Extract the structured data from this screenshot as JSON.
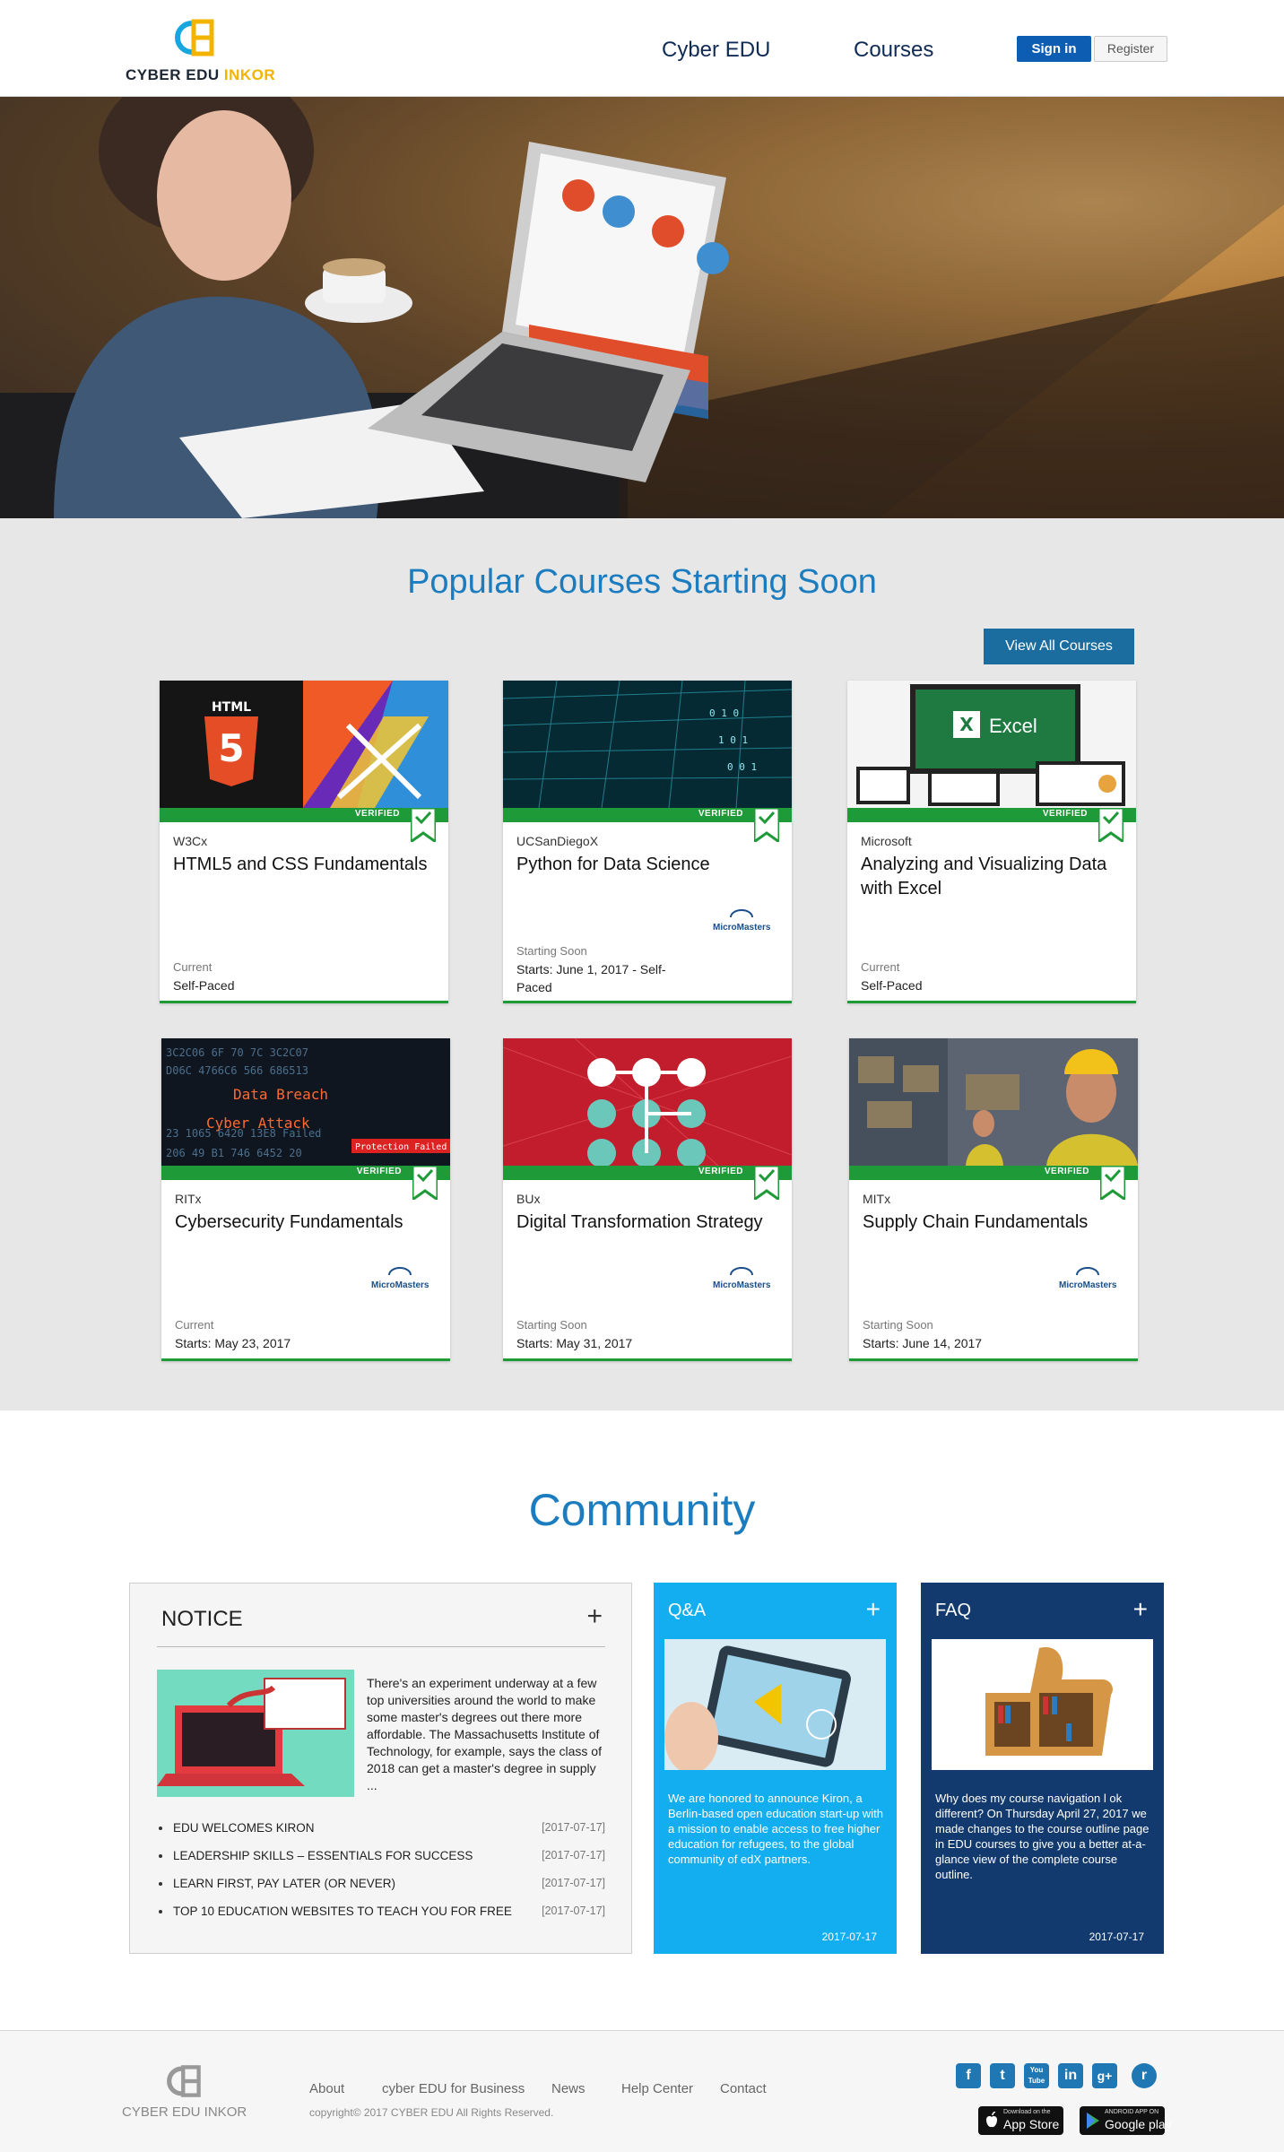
{
  "header": {
    "logo_text_main": "CYBER EDU",
    "logo_text_accent": "INKOR",
    "nav": [
      "Cyber EDU",
      "Courses"
    ],
    "signin_label": "Sign in",
    "register_label": "Register"
  },
  "courses": {
    "title": "Popular Courses Starting Soon",
    "view_all_label": "View All Courses",
    "verified_label": "VERIFIED",
    "micromasters_label": "MicroMasters",
    "items": [
      {
        "org": "W3Cx",
        "title": "HTML5 and CSS Fundamentals",
        "status": "Current",
        "date": "Self-Paced"
      },
      {
        "org": "UCSanDiegoX",
        "title": "Python for Data Science",
        "status": "Starting Soon",
        "date": "Starts: June 1, 2017 - Self-Paced"
      },
      {
        "org": "Microsoft",
        "title": "Analyzing and Visualizing Data with Excel",
        "status": "Current",
        "date": "Self-Paced"
      },
      {
        "org": "RITx",
        "title": "Cybersecurity Fundamentals",
        "status": "Current",
        "date": "Starts: May 23, 2017"
      },
      {
        "org": "BUx",
        "title": "Digital Transformation Strategy",
        "status": "Starting Soon",
        "date": "Starts: May 31, 2017"
      },
      {
        "org": "MITx",
        "title": "Supply Chain Fundamentals",
        "status": "Starting Soon",
        "date": "Starts: June 14, 2017"
      }
    ],
    "image_text": {
      "html_badge": "HTML",
      "excel": "Excel",
      "data_breach": "Data Breach",
      "cyber_attack": "Cyber Attack",
      "protection_failed": "Protection Failed"
    }
  },
  "community": {
    "title": "Community",
    "notice": {
      "title": "NOTICE",
      "text": "There's an experiment underway at a few top universities around the world to make some master's degrees out there more affordable. The Massachusetts Institute of Technology, for example, says the class of 2018 can get a master's degree in supply ...",
      "list": [
        {
          "title": "EDU WELCOMES KIRON",
          "date": "[2017-07-17]"
        },
        {
          "title": "LEADERSHIP SKILLS – ESSENTIALS FOR SUCCESS",
          "date": "[2017-07-17]"
        },
        {
          "title": "LEARN FIRST, PAY LATER (OR NEVER)",
          "date": "[2017-07-17]"
        },
        {
          "title": "TOP 10 EDUCATION WEBSITES TO TEACH YOU FOR FREE",
          "date": "[2017-07-17]"
        }
      ]
    },
    "qa": {
      "title": "Q&A",
      "text": "We are honored to announce Kiron, a Berlin-based open education start-up with a mission to enable access to free higher education for refugees, to the global community of edX partners.",
      "date": "2017-07-17"
    },
    "faq": {
      "title": "FAQ",
      "text": "Why does my course navigation l ok different? On Thursday April 27, 2017 we made changes to the course outline page in EDU courses to give you a better at-a-glance view of the complete course outline.",
      "date": "2017-07-17"
    },
    "plus": "+"
  },
  "footer": {
    "logo_text": "CYBER EDU INKOR",
    "links": [
      "About",
      "cyber EDU for Business",
      "News",
      "Help Center",
      "Contact"
    ],
    "copyright": "copyright© 2017 CYBER EDU All Rights Reserved.",
    "social": [
      "f",
      "t",
      "You Tube",
      "in",
      "g+",
      "r"
    ],
    "app_store_small": "Download on the",
    "app_store": "App Store",
    "google_play_small": "ANDROID APP ON",
    "google_play": "Google play"
  },
  "colors": {
    "accent_blue": "#1b7dbf",
    "verified_green": "#1f9a38",
    "qa_panel": "#13aef0",
    "faq_panel": "#123a6e",
    "signin": "#0d5db3",
    "logo_yellow": "#f2b400"
  }
}
